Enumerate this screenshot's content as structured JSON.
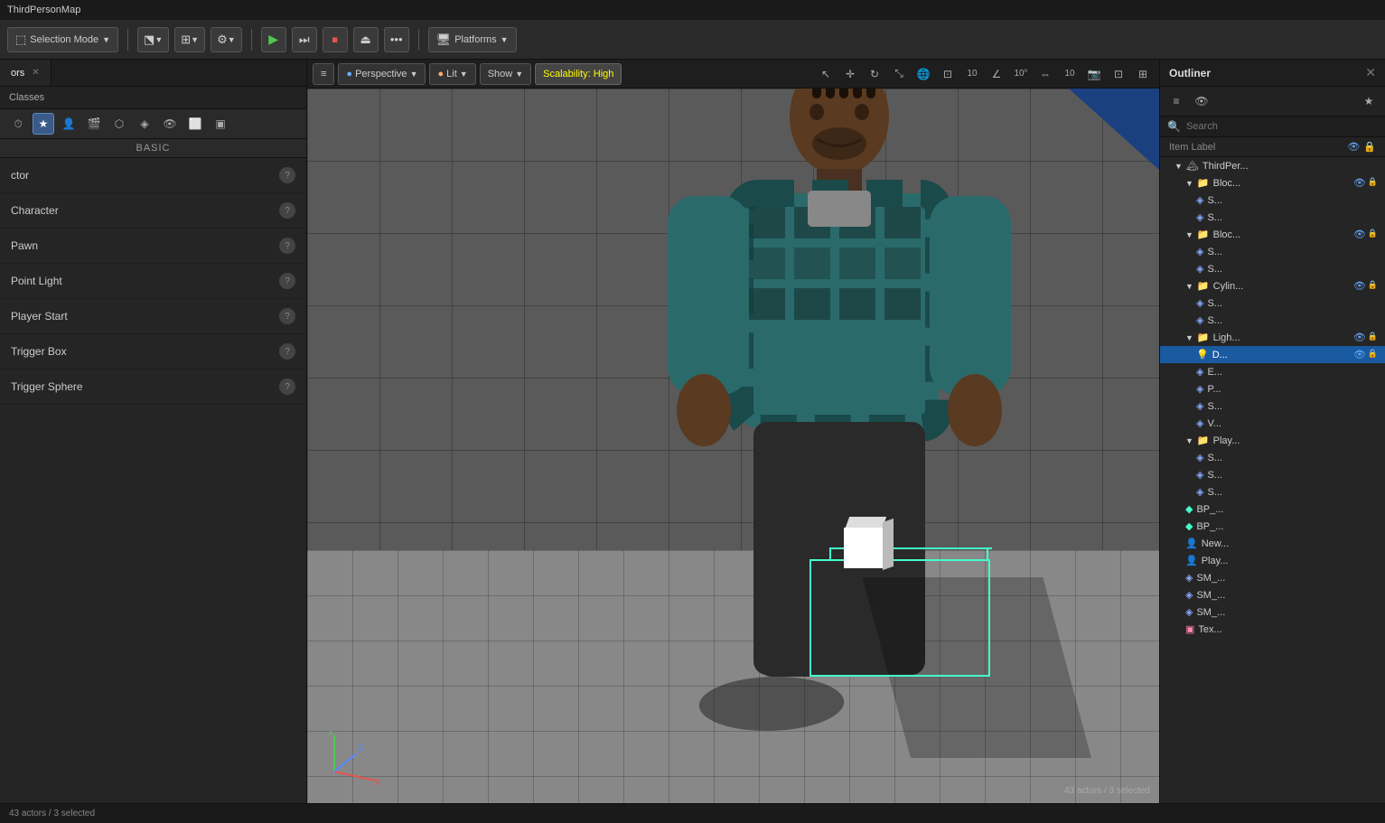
{
  "app": {
    "title": "ThirdPersonMap"
  },
  "toolbar": {
    "selection_mode_label": "Selection Mode",
    "platforms_label": "Platforms",
    "play_label": "▶",
    "step_label": "⏭",
    "stop_label": "⏹",
    "eject_label": "⏏",
    "more_label": "•••"
  },
  "viewport": {
    "perspective_label": "Perspective",
    "lit_label": "Lit",
    "show_label": "Show",
    "scalability_label": "Scalability: High"
  },
  "left_panel": {
    "tab_label": "ors",
    "classes_label": "Classes",
    "basic_label": "BASIC",
    "items": [
      {
        "name": "ctor",
        "label": "ctor"
      },
      {
        "name": "Character",
        "label": "Character"
      },
      {
        "name": "Pawn",
        "label": "Pawn"
      },
      {
        "name": "Point Light",
        "label": "Point Light"
      },
      {
        "name": "Player Start",
        "label": "Player Start"
      },
      {
        "name": "Trigger Box",
        "label": "Trigger Box"
      },
      {
        "name": "Trigger Sphere",
        "label": "Trigger Sphere"
      }
    ]
  },
  "outliner": {
    "title": "Outliner",
    "search_placeholder": "Search",
    "columns": {
      "item_label": "Item Label"
    },
    "tree_items": [
      {
        "label": "ThirdPerson...",
        "indent": 1,
        "type": "root"
      },
      {
        "label": "Bloc...",
        "indent": 2,
        "type": "group"
      },
      {
        "label": "S...",
        "indent": 3,
        "type": "mesh"
      },
      {
        "label": "S...",
        "indent": 3,
        "type": "mesh"
      },
      {
        "label": "Bloc...",
        "indent": 2,
        "type": "group"
      },
      {
        "label": "S...",
        "indent": 3,
        "type": "mesh"
      },
      {
        "label": "S...",
        "indent": 3,
        "type": "mesh"
      },
      {
        "label": "Cylin...",
        "indent": 2,
        "type": "group"
      },
      {
        "label": "S...",
        "indent": 3,
        "type": "mesh"
      },
      {
        "label": "S...",
        "indent": 3,
        "type": "mesh"
      },
      {
        "label": "Ligh...",
        "indent": 2,
        "type": "group"
      },
      {
        "label": "D...",
        "indent": 3,
        "type": "light",
        "selected": true
      },
      {
        "label": "E...",
        "indent": 3,
        "type": "light"
      },
      {
        "label": "P...",
        "indent": 3,
        "type": "light"
      },
      {
        "label": "S...",
        "indent": 3,
        "type": "light"
      },
      {
        "label": "V...",
        "indent": 3,
        "type": "volume"
      },
      {
        "label": "Play...",
        "indent": 2,
        "type": "group"
      },
      {
        "label": "S...",
        "indent": 3,
        "type": "mesh"
      },
      {
        "label": "S...",
        "indent": 3,
        "type": "mesh"
      },
      {
        "label": "S...",
        "indent": 3,
        "type": "mesh"
      },
      {
        "label": "BP_...",
        "indent": 2,
        "type": "blueprint"
      },
      {
        "label": "BP_...",
        "indent": 2,
        "type": "blueprint"
      },
      {
        "label": "New...",
        "indent": 2,
        "type": "actor"
      },
      {
        "label": "Play...",
        "indent": 2,
        "type": "actor"
      },
      {
        "label": "SM_...",
        "indent": 2,
        "type": "mesh"
      },
      {
        "label": "SM_...",
        "indent": 2,
        "type": "mesh"
      },
      {
        "label": "SM_...",
        "indent": 2,
        "type": "mesh"
      },
      {
        "label": "Tex...",
        "indent": 2,
        "type": "texture"
      }
    ]
  },
  "status_bar": {
    "info": "43 actors / 3 selected"
  }
}
